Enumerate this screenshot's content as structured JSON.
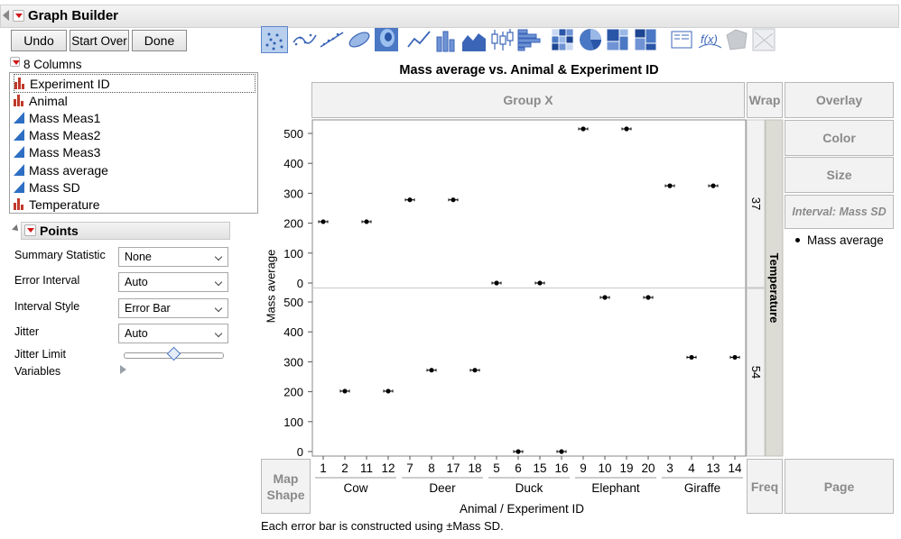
{
  "window": {
    "title": "Graph Builder"
  },
  "buttons": {
    "undo": "Undo",
    "start_over": "Start Over",
    "done": "Done"
  },
  "columns": {
    "header": "8 Columns",
    "items": [
      {
        "label": "Experiment ID",
        "icon": "nominal-icon"
      },
      {
        "label": "Animal",
        "icon": "nominal-icon"
      },
      {
        "label": "Mass Meas1",
        "icon": "continuous-icon"
      },
      {
        "label": "Mass Meas2",
        "icon": "continuous-icon"
      },
      {
        "label": "Mass Meas3",
        "icon": "continuous-icon"
      },
      {
        "label": "Mass average",
        "icon": "continuous-icon"
      },
      {
        "label": "Mass SD",
        "icon": "continuous-icon"
      },
      {
        "label": "Temperature",
        "icon": "nominal-icon"
      }
    ]
  },
  "points_panel": {
    "title": "Points",
    "options": [
      {
        "label": "Summary Statistic",
        "value": "None"
      },
      {
        "label": "Error Interval",
        "value": "Auto"
      },
      {
        "label": "Interval Style",
        "value": "Error Bar"
      },
      {
        "label": "Jitter",
        "value": "Auto"
      }
    ],
    "jitter_limit_label": "Jitter Limit",
    "variables_label": "Variables"
  },
  "zones": {
    "group_x": "Group X",
    "wrap": "Wrap",
    "overlay": "Overlay",
    "color": "Color",
    "size": "Size",
    "interval": "Interval: Mass SD",
    "map_shape": "Map\nShape",
    "freq": "Freq",
    "page": "Page",
    "group_y_title": "Temperature"
  },
  "legend": {
    "items": [
      "Mass average"
    ]
  },
  "footer": "Each error bar is constructed using ±Mass SD.",
  "colors": {
    "accent_red": "#d01818",
    "nominal": "#c0392b",
    "continuous": "#2e6fc4",
    "panel_blue": "#4b78c4"
  },
  "chart_data": {
    "type": "scatter",
    "title": "Mass average vs. Animal & Experiment ID",
    "ylabel": "Mass average",
    "xlabel": "Animal / Experiment ID",
    "ylim": [
      0,
      500
    ],
    "yticks": [
      0,
      100,
      200,
      300,
      400,
      500
    ],
    "x_groups": [
      {
        "name": "Cow",
        "ids": [
          "1",
          "2",
          "11",
          "12"
        ]
      },
      {
        "name": "Deer",
        "ids": [
          "7",
          "8",
          "17",
          "18"
        ]
      },
      {
        "name": "Duck",
        "ids": [
          "5",
          "6",
          "15",
          "16"
        ]
      },
      {
        "name": "Elephant",
        "ids": [
          "9",
          "10",
          "19",
          "20"
        ]
      },
      {
        "name": "Giraffe",
        "ids": [
          "3",
          "4",
          "13",
          "14"
        ]
      }
    ],
    "panels": [
      {
        "temperature": "37",
        "values": [
          205,
          null,
          205,
          null,
          278,
          null,
          278,
          null,
          0,
          null,
          0,
          null,
          515,
          null,
          515,
          null,
          325,
          null,
          325,
          null
        ]
      },
      {
        "temperature": "54",
        "values": [
          null,
          202,
          null,
          202,
          null,
          272,
          null,
          272,
          null,
          0,
          null,
          0,
          null,
          515,
          null,
          515,
          null,
          315,
          null,
          315
        ]
      }
    ],
    "grid": false,
    "legend": "right"
  }
}
